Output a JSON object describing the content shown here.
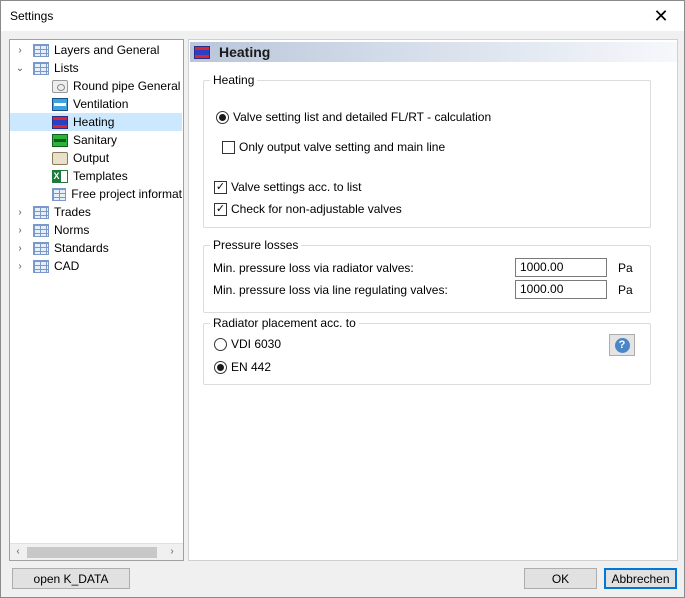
{
  "window": {
    "title": "Settings",
    "close_glyph": "✕"
  },
  "tree": {
    "items": [
      {
        "label": "Layers and General",
        "icon": "table-icon",
        "expander": "›"
      },
      {
        "label": "Lists",
        "icon": "table-icon",
        "expander": "⌄"
      },
      {
        "label": "Round pipe General",
        "icon": "pipe-icon"
      },
      {
        "label": "Ventilation",
        "icon": "ventilation-icon"
      },
      {
        "label": "Heating",
        "icon": "heating-icon",
        "selected": true
      },
      {
        "label": "Sanitary",
        "icon": "sanitary-icon"
      },
      {
        "label": "Output",
        "icon": "output-icon"
      },
      {
        "label": "Templates",
        "icon": "excel-icon"
      },
      {
        "label": "Free project informat",
        "icon": "table-icon"
      },
      {
        "label": "Trades",
        "icon": "table-icon",
        "expander": "›"
      },
      {
        "label": "Norms",
        "icon": "table-icon",
        "expander": "›"
      },
      {
        "label": "Standards",
        "icon": "table-icon",
        "expander": "›"
      },
      {
        "label": "CAD",
        "icon": "table-icon",
        "expander": "›"
      }
    ],
    "scroll_left": "‹",
    "scroll_right": "›"
  },
  "panel": {
    "title": "Heating",
    "heating_group": {
      "label": "Heating",
      "radio_valve_list": "Valve setting list and detailed FL/RT - calculation",
      "check_only_output": "Only output valve setting and main line",
      "check_valve_settings": "Valve settings acc. to list",
      "check_non_adjustable": "Check for non-adjustable valves",
      "check_mark": "✓"
    },
    "pressure_group": {
      "label": "Pressure losses",
      "radiator_label": "Min. pressure loss via radiator valves:",
      "radiator_value": "1000.00",
      "line_label": "Min. pressure loss via line regulating valves:",
      "line_value": "1000.00",
      "unit": "Pa"
    },
    "radiator_group": {
      "label": "Radiator placement acc. to",
      "option_vdi": "VDI 6030",
      "option_en": "EN 442",
      "help_glyph": "?"
    }
  },
  "footer": {
    "open_k_data": "open K_DATA",
    "ok": "OK",
    "cancel": "Abbrechen"
  }
}
